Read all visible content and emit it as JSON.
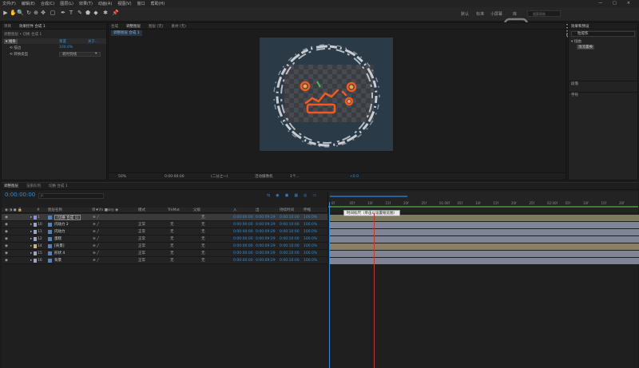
{
  "menubar": {
    "items": [
      "文件(F)",
      "编辑(E)",
      "合成(C)",
      "图层(L)",
      "效果(T)",
      "动画(A)",
      "视图(V)",
      "窗口",
      "帮助(H)"
    ],
    "controls": [
      "—",
      "□",
      "×"
    ]
  },
  "toolbar": {
    "tools": [
      "▶",
      "✋",
      "🔍",
      "↻",
      "⊕",
      "✥",
      "▢",
      "✒",
      "T",
      "✎",
      "⬟",
      "◆",
      "✱",
      "📌"
    ],
    "workspaces": [
      "默认",
      "标准",
      "小屏幕",
      "库"
    ],
    "search_placeholder": "搜索帮助"
  },
  "watermark": "虎课网",
  "effects_panel": {
    "tabs": [
      "项目",
      "效果控件 合成 1"
    ],
    "breadcrumb": "调整图层 • 切换 合成 1",
    "rows": [
      {
        "label": "▾ 线条",
        "value": "重置",
        "extra": "关于..."
      },
      {
        "label": "⟲ 描边",
        "value": "100.0%",
        "extra": ""
      },
      {
        "label": "⟲ 转换类型",
        "value": "耗时到线",
        "extra": "▾"
      }
    ]
  },
  "viewer": {
    "tabs": [
      "合成",
      "调整图层",
      "图层 (无)",
      "素材 (无)"
    ],
    "subtab": "调整图层 合成 1",
    "footer": [
      "50%",
      "0:00:00:00",
      "(二分之一)",
      "活动摄像机",
      "1个...",
      "+0.0"
    ]
  },
  "right_panel": {
    "tab": "效果和预设",
    "search_value": "粒提炼",
    "tree": [
      "▾ 扭曲",
      "湍流置换"
    ],
    "sections": [
      "段落",
      "字符"
    ]
  },
  "timeline": {
    "tabs": [
      "调整图层",
      "渲染队列",
      "切换 合成 1"
    ],
    "timecode": "0:00:00:00",
    "search_placeholder": "ρ.",
    "headers": [
      "图层名称",
      "单♦\\fx ■⊘◎ ◉",
      "模式",
      "TrkMat",
      "父级",
      "入",
      "出",
      "持续时间",
      "伸缩"
    ],
    "layers": [
      {
        "num": "1",
        "name": "[切换 合成 1]",
        "mode": "",
        "trk": "",
        "parent": "无",
        "in": "0:00:00:00",
        "out": "0:00:09:29",
        "dur": "0:00:10:00",
        "stretch": "100.0%",
        "color": "#8a8fd6",
        "bar": "#7d7b5f",
        "selected": true
      },
      {
        "num": "10",
        "name": "闪动力 2",
        "mode": "正常",
        "trk": "无",
        "parent": "无",
        "in": "0:00:00:00",
        "out": "0:00:09:29",
        "dur": "0:00:10:00",
        "stretch": "100.0%",
        "color": "#9aa6c4",
        "bar": "#7f8594",
        "selected": false
      },
      {
        "num": "11",
        "name": "闪动力",
        "mode": "正常",
        "trk": "无",
        "parent": "无",
        "in": "0:00:00:00",
        "out": "0:00:09:29",
        "dur": "0:00:10:00",
        "stretch": "100.0%",
        "color": "#9aa6c4",
        "bar": "#7f8594",
        "selected": false
      },
      {
        "num": "12",
        "name": "蛋糕",
        "mode": "正常",
        "trk": "无",
        "parent": "无",
        "in": "0:00:00:00",
        "out": "0:00:09:29",
        "dur": "0:00:10:00",
        "stretch": "100.0%",
        "color": "#9aa6c4",
        "bar": "#7f8594",
        "selected": false
      },
      {
        "num": "14",
        "name": "[背景]",
        "mode": "正常",
        "trk": "无",
        "parent": "无",
        "in": "0:00:00:00",
        "out": "0:00:09:29",
        "dur": "0:00:10:00",
        "stretch": "100.0%",
        "color": "#c9b38a",
        "bar": "#8b8065",
        "selected": false
      },
      {
        "num": "15",
        "name": "形状 4",
        "mode": "正常",
        "trk": "无",
        "parent": "无",
        "in": "0:00:00:00",
        "out": "0:00:09:29",
        "dur": "0:00:10:00",
        "stretch": "100.0%",
        "color": "#9aa6c4",
        "bar": "#7f8594",
        "selected": false
      },
      {
        "num": "16",
        "name": "背景",
        "mode": "正常",
        "trk": "无",
        "parent": "无",
        "in": "0:00:00:00",
        "out": "0:00:09:29",
        "dur": "0:00:10:00",
        "stretch": "100.0%",
        "color": "#9aa6c4",
        "bar": "#7f8594",
        "selected": false
      }
    ],
    "ruler": [
      "0f",
      "05f",
      "10f",
      "15f",
      "20f",
      "25f",
      "01:00f",
      "05f",
      "10f",
      "15f",
      "20f",
      "25f",
      "02:00f",
      "05f",
      "10f",
      "15f",
      "20f"
    ],
    "tooltip": "时间标尺（单击以设置缩览图）"
  },
  "colors": {
    "accent": "#2f8ed7",
    "work_area": "#2d5f9a",
    "playhead": "#c0392b"
  }
}
